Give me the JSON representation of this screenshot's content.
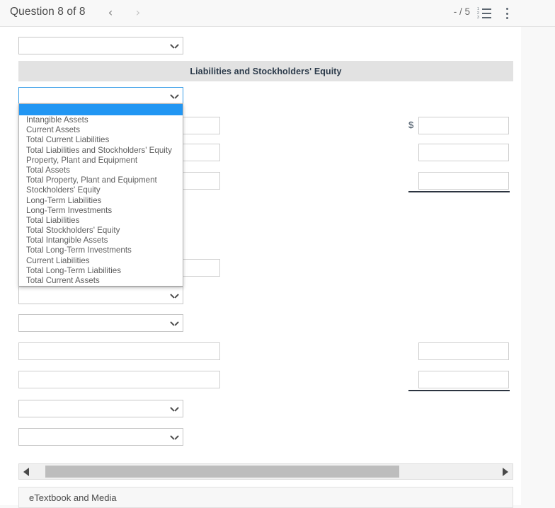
{
  "header": {
    "question_label": "Question 8 of 8",
    "prev_icon": "chevron-left-icon",
    "next_icon": "chevron-right-icon",
    "score": "- / 5",
    "list_icon": "numbered-list-icon",
    "menu_icon": "kebab-menu-icon"
  },
  "form": {
    "section_header": "Liabilities and Stockholders' Equity",
    "currency_symbol": "$",
    "selects": [
      {
        "name": "account-select-1",
        "value": ""
      },
      {
        "name": "account-select-2",
        "value": ""
      },
      {
        "name": "account-select-3",
        "value": ""
      },
      {
        "name": "account-select-4",
        "value": ""
      },
      {
        "name": "account-select-5",
        "value": ""
      },
      {
        "name": "account-select-6",
        "value": ""
      }
    ],
    "amount_inputs": [
      {
        "name": "amount-input-1",
        "value": ""
      },
      {
        "name": "amount-input-2",
        "value": ""
      },
      {
        "name": "amount-input-3",
        "value": ""
      },
      {
        "name": "amount-input-4",
        "value": ""
      },
      {
        "name": "amount-input-5",
        "value": ""
      },
      {
        "name": "amount-input-6",
        "value": ""
      },
      {
        "name": "amount-input-7",
        "value": ""
      },
      {
        "name": "amount-input-8",
        "value": ""
      },
      {
        "name": "amount-input-9",
        "value": ""
      }
    ]
  },
  "dropdown": {
    "open": true,
    "highlight_color": "#2196f3",
    "selected_index": 0,
    "options": [
      "",
      "Intangible Assets",
      "Current Assets",
      "Total Current Liabilities",
      "Total Liabilities and Stockholders' Equity",
      "Property, Plant and Equipment",
      "Total Assets",
      "Total Property, Plant and Equipment",
      "Stockholders' Equity",
      "Long-Term Liabilities",
      "Long-Term Investments",
      "Total Liabilities",
      "Total Stockholders' Equity",
      "Total Intangible Assets",
      "Total Long-Term Investments",
      "Current Liabilities",
      "Total Long-Term Liabilities",
      "Total Current Assets"
    ]
  },
  "scrollbar": {
    "left_arrow_icon": "triangle-left-icon",
    "right_arrow_icon": "triangle-right-icon"
  },
  "footer": {
    "etextbook_label": "eTextbook and Media"
  }
}
